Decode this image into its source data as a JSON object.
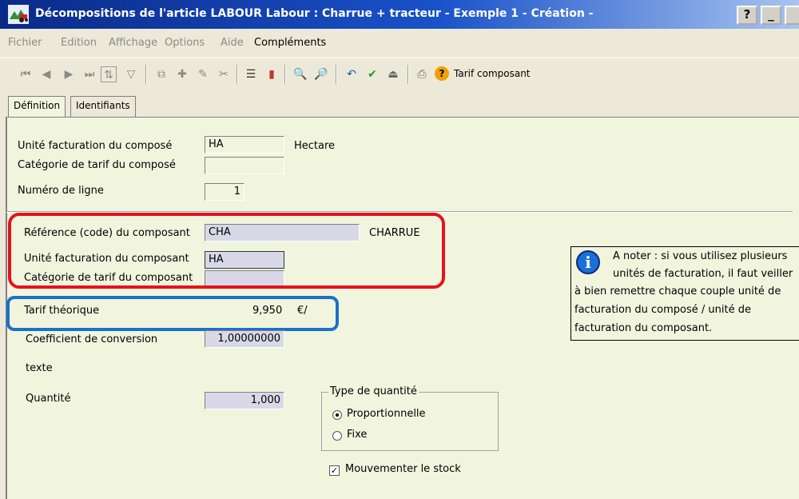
{
  "window": {
    "title": "Décompositions de l'article LABOUR Labour : Charrue + tracteur - Exemple 1 - Création -",
    "help_btn": "?",
    "min_btn": "_"
  },
  "menu": {
    "items": [
      "Fichier",
      "Edition",
      "Affichage",
      "Options",
      "Aide",
      "Compléments"
    ]
  },
  "toolbar": {
    "tarif_label": "Tarif composant"
  },
  "tabs": [
    "Définition",
    "Identifiants"
  ],
  "form": {
    "unite_compose_label": "Unité facturation du composé",
    "unite_compose_value": "HA",
    "unite_compose_desc": "Hectare",
    "categorie_compose_label": "Catégorie de tarif du composé",
    "categorie_compose_value": "",
    "numero_ligne_label": "Numéro de ligne",
    "numero_ligne_value": "1",
    "reference_label": "Référence (code) du composant",
    "reference_value": "CHA",
    "reference_desc": "CHARRUE",
    "unite_composant_label": "Unité facturation du composant",
    "unite_composant_value": "HA",
    "categorie_composant_label": "Catégorie de tarif du composant",
    "categorie_composant_value": "",
    "tarif_label": "Tarif théorique",
    "tarif_value": "9,950",
    "tarif_unit": "€/",
    "coef_label": "Coefficient de conversion",
    "coef_value": "1,00000000",
    "texte_label": "texte",
    "quantite_label": "Quantité",
    "quantite_value": "1,000",
    "type_quantite_label": "Type de quantité",
    "option_proportionnelle": "Proportionnelle",
    "option_fixe": "Fixe",
    "mouvementer_label": "Mouvementer le stock"
  },
  "note": {
    "lines": [
      "A noter : si vous utilisez plusieurs",
      "unités de facturation, il faut veiller",
      "à bien remettre chaque couple unité de",
      "facturation du composé / unité de",
      "facturation du composant."
    ]
  }
}
